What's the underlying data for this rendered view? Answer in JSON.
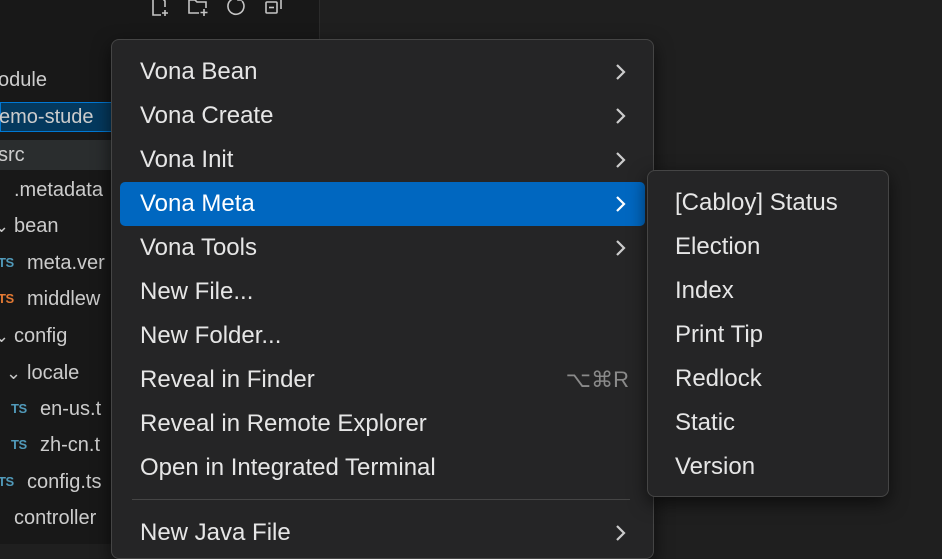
{
  "sidebar": {
    "toolbar_icons": [
      "new-file-icon",
      "new-folder-icon",
      "refresh-icon",
      "collapse-all-icon"
    ],
    "tree": [
      {
        "label": "odule",
        "indent": 0,
        "type": "text"
      },
      {
        "label": "emo-stude",
        "indent": 0,
        "type": "selected"
      },
      {
        "label": "src",
        "indent": 0,
        "type": "active"
      },
      {
        "label": ".metadata",
        "indent": 1,
        "type": "text"
      },
      {
        "label": "bean",
        "indent": 0,
        "type": "folder"
      },
      {
        "label": "meta.ver",
        "indent": 0,
        "type": "ts-blue"
      },
      {
        "label": "middlew",
        "indent": 0,
        "type": "ts-orange"
      },
      {
        "label": "config",
        "indent": 0,
        "type": "folder"
      },
      {
        "label": "locale",
        "indent": 1,
        "type": "folder"
      },
      {
        "label": "en-us.t",
        "indent": 2,
        "type": "ts-blue"
      },
      {
        "label": "zh-cn.t",
        "indent": 2,
        "type": "ts-blue"
      },
      {
        "label": "config.ts",
        "indent": 0,
        "type": "ts-blue"
      },
      {
        "label": "controller",
        "indent": 0,
        "type": "folder"
      }
    ]
  },
  "context_menu": {
    "items": [
      {
        "label": "Vona Bean",
        "submenu": true
      },
      {
        "label": "Vona Create",
        "submenu": true
      },
      {
        "label": "Vona Init",
        "submenu": true
      },
      {
        "label": "Vona Meta",
        "submenu": true,
        "highlighted": true
      },
      {
        "label": "Vona Tools",
        "submenu": true
      },
      {
        "label": "New File...",
        "submenu": false
      },
      {
        "label": "New Folder...",
        "submenu": false
      },
      {
        "label": "Reveal in Finder",
        "submenu": false,
        "shortcut": "⌥⌘R"
      },
      {
        "label": "Reveal in Remote Explorer",
        "submenu": false
      },
      {
        "label": "Open in Integrated Terminal",
        "submenu": false
      },
      {
        "label": "New Java File",
        "submenu": true
      }
    ]
  },
  "submenu": {
    "items": [
      "[Cabloy] Status",
      "Election",
      "Index",
      "Print Tip",
      "Redlock",
      "Static",
      "Version"
    ]
  },
  "colors": {
    "highlight": "#0067c0",
    "menu_bg": "#252526",
    "ts_blue": "#519aba",
    "ts_orange": "#e37933"
  }
}
